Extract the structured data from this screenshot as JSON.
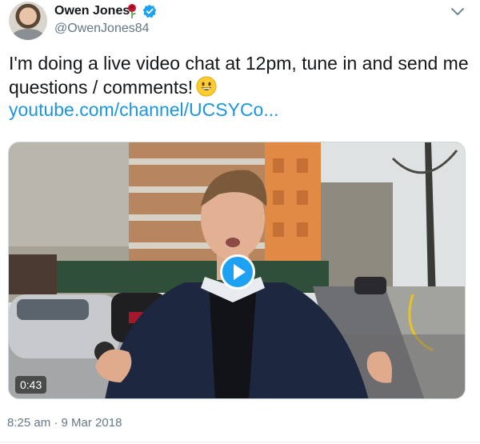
{
  "author": {
    "name": "Owen Jones",
    "handle": "@OwenJones84",
    "badge_icon": "verified-badge-icon",
    "name_emoji_icon": "rose-icon"
  },
  "menu_icon": "chevron-down-icon",
  "tweet": {
    "text": "I'm doing a live video chat at 12pm, tune in and send me questions / comments!",
    "emoji_icon": "grinning-face-icon",
    "link_text": "youtube.com/channel/UCSYCo..."
  },
  "video": {
    "duration": "0:43",
    "play_icon": "play-icon"
  },
  "timestamp": "8:25 am · 9 Mar 2018",
  "colors": {
    "link": "#1b95e0",
    "verified": "#1da1f2",
    "play_button": "#1da1f2",
    "secondary_text": "#657786"
  }
}
